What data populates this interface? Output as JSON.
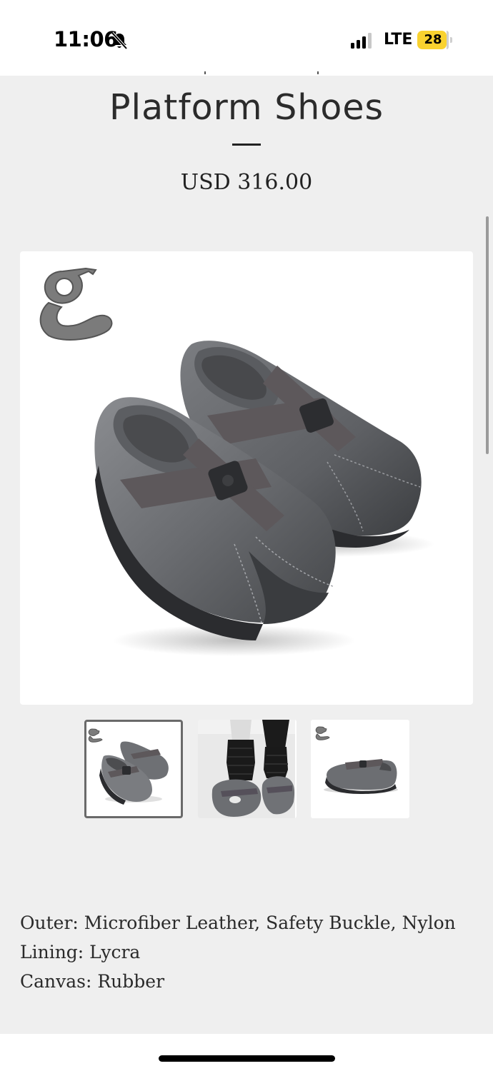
{
  "status_bar": {
    "time": "11:06",
    "network": "LTE",
    "battery": "28",
    "battery_color": "#f9d22f"
  },
  "product": {
    "title": "Platform Shoes",
    "price": "USD 316.00",
    "details": [
      "Outer: Microfiber Leather, Safety Buckle, Nylon",
      "Lining: Lycra",
      "Canvas: Rubber"
    ]
  },
  "gallery": {
    "main_image": "shoes-pair-main",
    "thumbnails": [
      {
        "name": "thumbnail-pair",
        "selected": true
      },
      {
        "name": "thumbnail-worn-with-leg-warmers",
        "selected": false
      },
      {
        "name": "thumbnail-side-view",
        "selected": false
      }
    ]
  },
  "colors": {
    "background": "#efefef",
    "shoe_leather": "#6d6f72",
    "shoe_dark": "#3b3d40",
    "strap": "#5b5659"
  }
}
